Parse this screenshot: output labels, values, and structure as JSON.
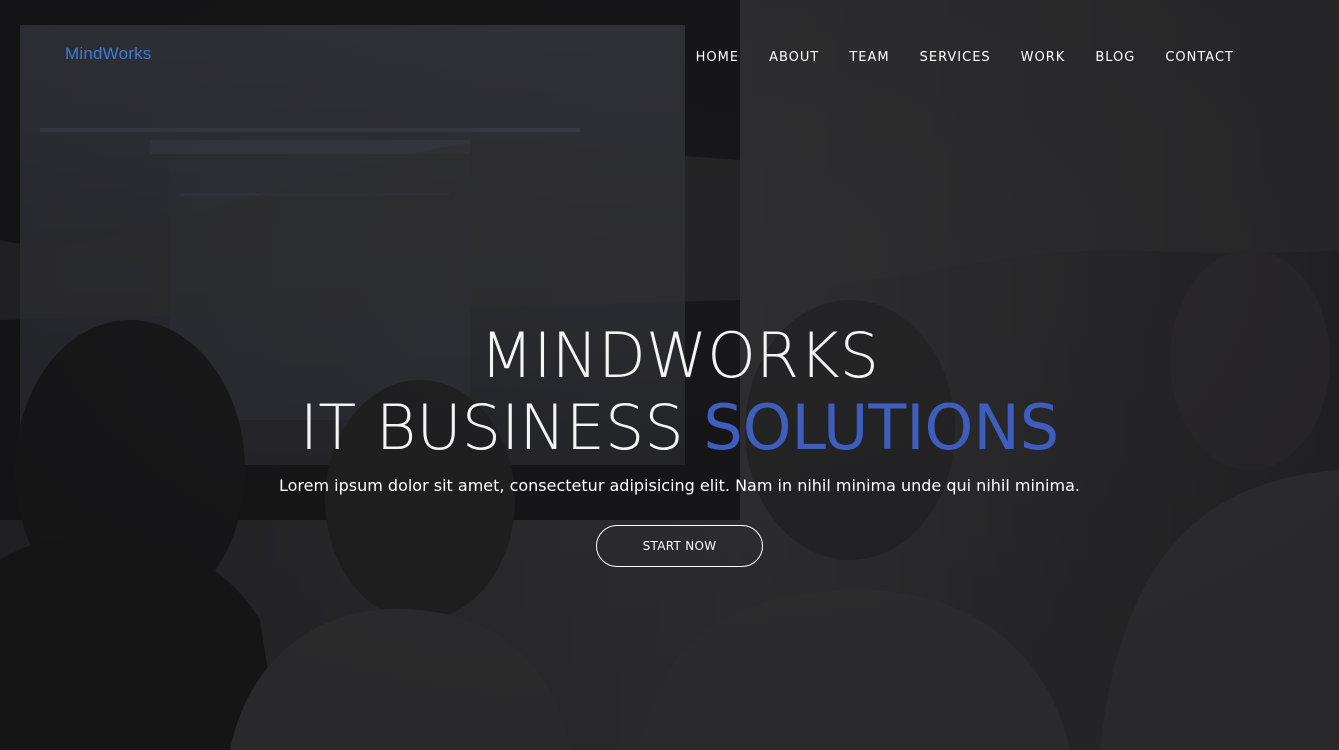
{
  "brand": {
    "name": "MindWorks",
    "color": "#3d7bd9"
  },
  "nav": {
    "items": [
      {
        "label": "HOME"
      },
      {
        "label": "ABOUT"
      },
      {
        "label": "TEAM"
      },
      {
        "label": "SERVICES"
      },
      {
        "label": "WORK"
      },
      {
        "label": "BLOG"
      },
      {
        "label": "CONTACT"
      }
    ]
  },
  "hero": {
    "title_line1": "MINDWORKS",
    "title_line2_prefix": "IT BUSINESS ",
    "title_line2_accent": "SOLUTIONS",
    "accent_color": "#3f5dbd",
    "subtitle": "Lorem ipsum dolor sit amet, consectetur adipisicing elit. Nam in nihil minima unde qui nihil minima.",
    "cta_label": "START NOW",
    "background": "dark-tinted photo of people in a meeting looking at a screen"
  }
}
